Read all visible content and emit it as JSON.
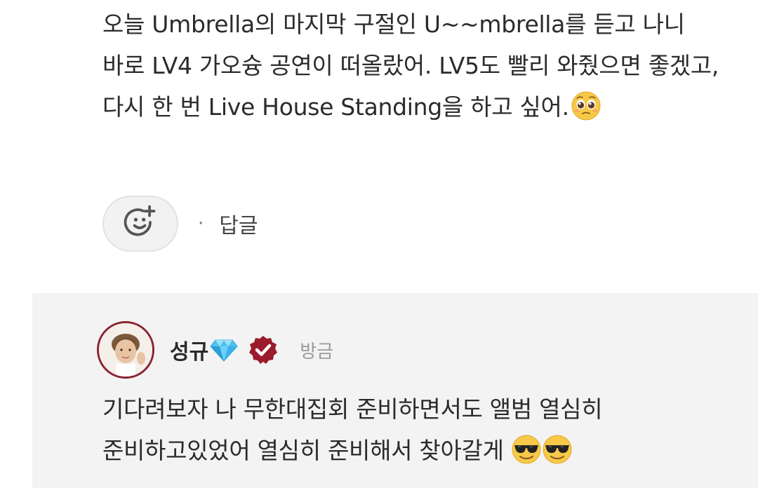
{
  "comment": {
    "text": "오늘 Umbrella의 마지막 구절인 U~~mbrella를 듣고 나니 바로 LV4 가오슝 공연이 떠올랐어. LV5도 빨리 와줬으면 좋겠고, 다시 한 번 Live House Standing을 하고 싶어.",
    "emoji": "pleading-face"
  },
  "actions": {
    "reaction_icon": "add-reaction-icon",
    "separator": "·",
    "reply_label": "답글"
  },
  "reply": {
    "author": "성규",
    "author_badge_icon": "gem-icon",
    "verified_icon": "verified-badge-icon",
    "time": "방금",
    "text": "기다려보자 나 무한대집회 준비하면서도 앨범 열심히 준비하고있었어 열심히 준비해서 찾아갈게",
    "emojis": [
      "smiling-face-with-sunglasses",
      "smiling-face-with-sunglasses"
    ]
  },
  "colors": {
    "text": "#2b2b2b",
    "reply_bg": "#f3f3f3",
    "avatar_ring": "#8b2331",
    "verified": "#9b1c2c",
    "gem": "#3fb3ec"
  }
}
